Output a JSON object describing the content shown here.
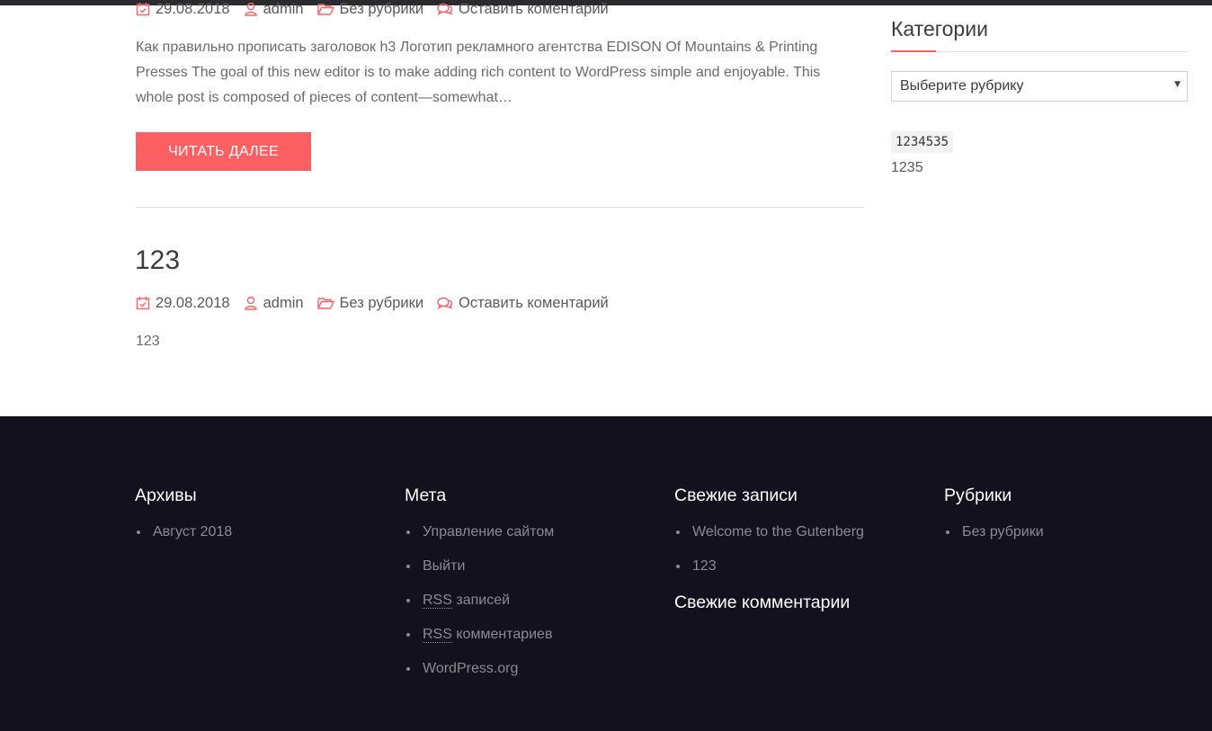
{
  "colors": {
    "accent": "#fd6062",
    "footer_bg": "#13111e",
    "text": "#5b5b5b"
  },
  "post1": {
    "meta": {
      "date": "29.08.2018",
      "author": "admin",
      "category": "Без рубрики",
      "comment": "Оставить коментарий"
    },
    "excerpt": "Как правильно прописать заголовок h3 Логотип рекламного агентства EDISON Of Mountains & Printing Presses The goal of this new editor is to make adding rich content to WordPress simple and enjoyable. This whole post is composed of pieces of content—somewhat…",
    "read_more": "Читать далее"
  },
  "post2": {
    "title": "123",
    "meta": {
      "date": "29.08.2018",
      "author": "admin",
      "category": "Без рубрики",
      "comment": "Оставить коментарий"
    },
    "body": "123"
  },
  "sidebar": {
    "title": "Категории",
    "select_value": "Выберите рубрику",
    "code": "1234535",
    "text": "1235"
  },
  "footer": {
    "archives": {
      "title": "Архивы",
      "items": [
        "Август 2018"
      ]
    },
    "meta": {
      "title": "Мета",
      "items": [
        "Управление сайтом",
        "Выйти",
        "записей",
        "комментариев",
        "WordPress.org"
      ],
      "rss": "RSS"
    },
    "recent_posts": {
      "title": "Свежие записи",
      "items": [
        "Welcome to the Gutenberg",
        "123"
      ]
    },
    "recent_comments": {
      "title": "Свежие комментарии"
    },
    "categories": {
      "title": "Рубрики",
      "items": [
        "Без рубрики"
      ]
    }
  },
  "icons": [
    "calendar-icon",
    "user-icon",
    "folder-icon",
    "comments-icon",
    "dropdown-arrow-icon"
  ]
}
